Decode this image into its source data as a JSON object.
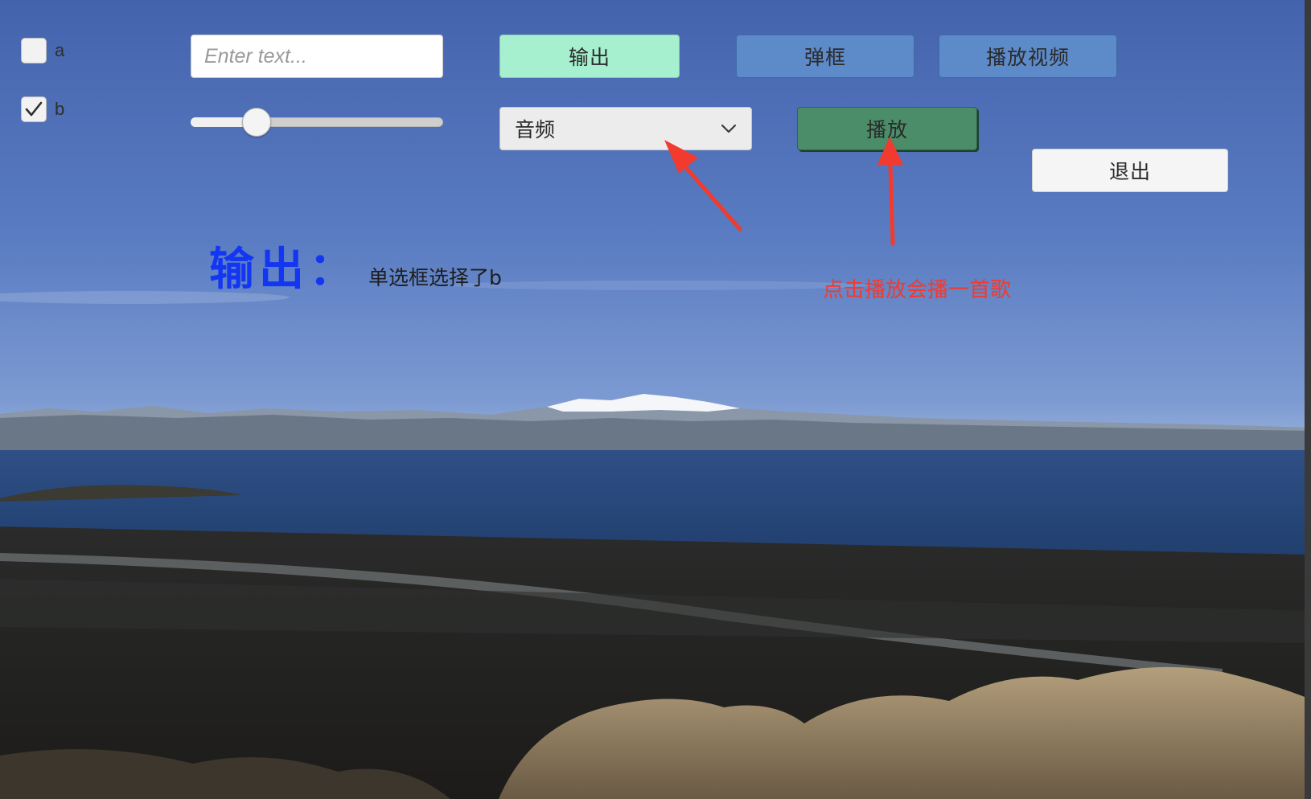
{
  "toggles": [
    {
      "label": "a",
      "checked": false
    },
    {
      "label": "b",
      "checked": true
    }
  ],
  "input": {
    "value": "",
    "placeholder": "Enter text..."
  },
  "slider": {
    "value": 0.23
  },
  "buttons": {
    "output": "输出",
    "popup": "弹框",
    "play_video": "播放视频",
    "play": "播放",
    "exit": "退出"
  },
  "dropdown": {
    "selected": "音频"
  },
  "output": {
    "label": "输出：",
    "value": "单选框选择了b"
  },
  "annotation": {
    "note": "点击播放会播一首歌"
  },
  "colors": {
    "output_button": "#a7f0cf",
    "blue_button": "#5d8ac8",
    "play_button": "#4b8d69",
    "output_label": "#1336f2",
    "annotation": "#f23a2e"
  },
  "icons": {
    "checkbox_check": "checkmark-icon",
    "dropdown_arrow": "chevron-down-icon"
  }
}
